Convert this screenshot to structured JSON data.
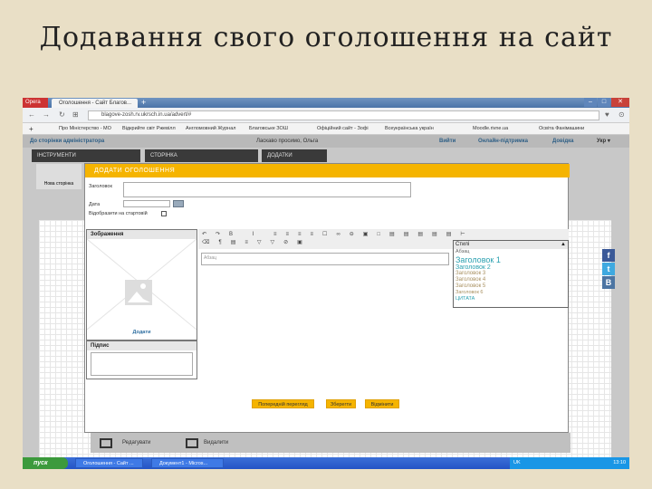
{
  "slide_title": "Додавання свого оголошення на сайт",
  "browser": {
    "app": "Opera",
    "tab_title": "Оголошення - Сайт Благов...",
    "url": "blagove-zosh.rv.ukrsch.in.ua/advert/#",
    "bookmarks": [
      "Про Міністерство - МО",
      "Відкрийте світ Ржевілл",
      "Англомовний Журнал",
      "Благовське ЗОШ",
      "Офіційний сайт - Зофі",
      "Всеукраїнська україн",
      "Moodle.rivne.ua",
      "Освіта Фанімашини"
    ]
  },
  "site_header": {
    "admin_link": "До сторінки адміністратора",
    "greeting": "Ласкаво просимо, Ольга",
    "login": "Вийти",
    "support": "Онлайн-підтримка",
    "help": "Довідка",
    "lang": "Укр ▾"
  },
  "tool_tabs": [
    "ІНСТРУМЕНТИ",
    "СТОРІНКА",
    "ДОДАТКИ"
  ],
  "new_page": "Нова сторінка",
  "modal": {
    "title": "ДОДАТИ ОГОЛОШЕННЯ",
    "title_label": "Заголовок",
    "date_label": "Дата",
    "show_on_home": "Відобразити на стартовій",
    "image_panel": "Зображення",
    "add_image": "Додати",
    "caption_panel": "Підпис",
    "editor_placeholder": "Абзац",
    "styles": {
      "header": "Стилі",
      "items": [
        "Абзац",
        "Заголовок 1",
        "Заголовок 2",
        "Заголовок 3",
        "Заголовок 4",
        "Заголовок 5",
        "Заголовок 6",
        "ЦИТАТА"
      ]
    },
    "buttons": {
      "preview": "Попередній перегляд",
      "save": "Зберегти",
      "cancel": "Відмінити"
    }
  },
  "bottom_actions": {
    "edit": "Редагувати",
    "delete": "Видалити"
  },
  "taskbar": {
    "start": "пуск",
    "tasks": [
      "Оголошення - Сайт ...",
      "Документ1 - Micros..."
    ],
    "lang": "UK",
    "time": "13:10"
  },
  "colors": {
    "accent": "#f5b400",
    "link": "#2e5f86"
  }
}
